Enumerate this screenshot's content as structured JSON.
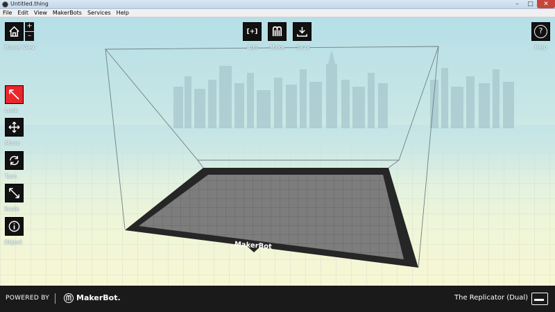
{
  "window": {
    "title": "Untitled.thing",
    "minimize": "–",
    "maximize": "□",
    "close": "✕"
  },
  "menu": [
    "File",
    "Edit",
    "View",
    "MakerBots",
    "Services",
    "Help"
  ],
  "toolbar_top": {
    "home_view": "Home View",
    "zoom_in": "+",
    "zoom_out": "–",
    "add": "Add",
    "add_glyph": "[+]",
    "make": "Make",
    "save": "Save",
    "help": "Help",
    "help_glyph": "?"
  },
  "tools": [
    {
      "label": "Look",
      "icon": "look-icon",
      "active": true
    },
    {
      "label": "Move",
      "icon": "move-icon",
      "active": false
    },
    {
      "label": "Turn",
      "icon": "turn-icon",
      "active": false
    },
    {
      "label": "Scale",
      "icon": "scale-icon",
      "active": false
    },
    {
      "label": "Object",
      "icon": "info-icon",
      "active": false
    }
  ],
  "build_plate_brand": "MakerBot",
  "footer": {
    "powered_by": "POWERED BY",
    "brand": "MakerBot.",
    "printer_name": "The Replicator (Dual)"
  },
  "colors": {
    "active_tool": "#e8262b",
    "toolbar_bg": "#111111",
    "footer_bg": "#1a1a1a"
  }
}
